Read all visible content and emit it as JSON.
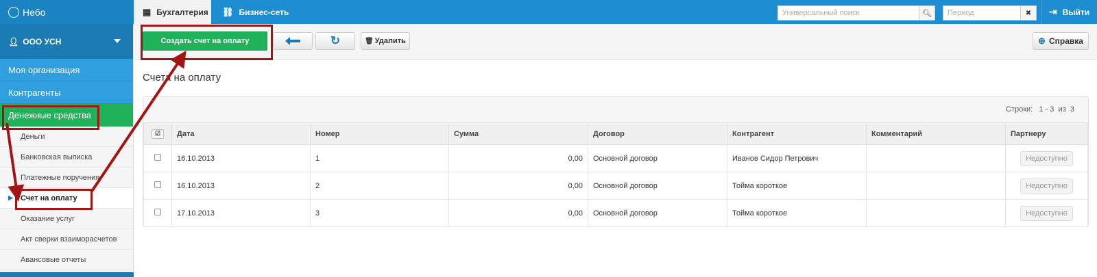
{
  "topbar": {
    "brand": "Небо",
    "tabs": [
      {
        "label": "Бухгалтерия",
        "icon": "calculator-icon"
      },
      {
        "label": "Бизнес-сеть",
        "icon": "network-icon"
      }
    ],
    "search_placeholder": "Универсальный поиск",
    "period_placeholder": "Период",
    "logout_label": "Выйти"
  },
  "sidebar": {
    "org_name": "ООО УСН",
    "items": [
      {
        "label": "Моя организация"
      },
      {
        "label": "Контрагенты"
      },
      {
        "label": "Денежные средства"
      }
    ],
    "subitems": [
      {
        "label": "Деньги"
      },
      {
        "label": "Банковская выписка"
      },
      {
        "label": "Платежные поручения"
      },
      {
        "label": "Счет на оплату"
      },
      {
        "label": "Оказание услуг"
      },
      {
        "label": "Акт сверки взаиморасчетов"
      },
      {
        "label": "Авансовые отчеты"
      }
    ]
  },
  "toolbar": {
    "create_label": "Создать счет на оплату",
    "delete_label": "Удалить",
    "help_label": "Справка"
  },
  "page": {
    "title": "Счета на оплату",
    "rows_label": "Строки:",
    "rows_range": "1 - 3",
    "rows_of": "из",
    "rows_total": "3"
  },
  "table": {
    "headers": [
      "Дата",
      "Номер",
      "Сумма",
      "Договор",
      "Контрагент",
      "Комментарий",
      "Партнеру"
    ],
    "rows": [
      {
        "date": "16.10.2013",
        "number": "1",
        "sum": "0,00",
        "contract": "Основной договор",
        "counterparty": "Иванов Сидор Петрович",
        "comment": "",
        "partner": "Недоступно"
      },
      {
        "date": "16.10.2013",
        "number": "2",
        "sum": "0,00",
        "contract": "Основной договор",
        "counterparty": "Тойма короткое",
        "comment": "",
        "partner": "Недоступно"
      },
      {
        "date": "17.10.2013",
        "number": "3",
        "sum": "0,00",
        "contract": "Основной договор",
        "counterparty": "Тойма короткое",
        "comment": "",
        "partner": "Недоступно"
      }
    ]
  },
  "colors": {
    "topbar": "#1c8dd0",
    "green": "#1fb25a",
    "annotation": "#a31515"
  }
}
